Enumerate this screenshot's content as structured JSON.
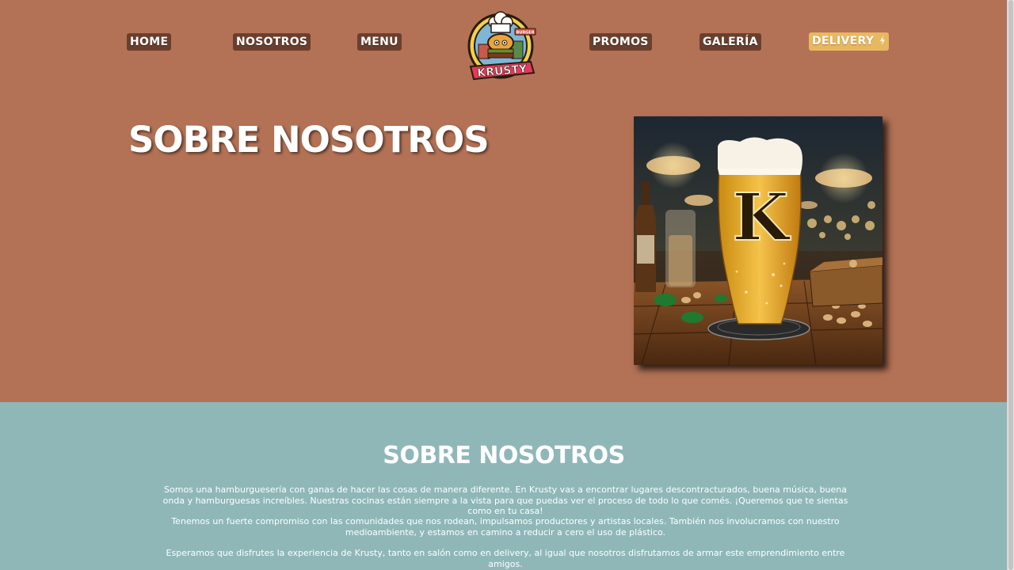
{
  "nav": {
    "items": [
      {
        "label": "HOME"
      },
      {
        "label": "NOSOTROS"
      },
      {
        "label": "MENU"
      },
      {
        "label": "PROMOS"
      },
      {
        "label": "GALERÍA"
      }
    ],
    "delivery_label": "DELIVERY"
  },
  "logo": {
    "text": "KRUSTY",
    "sign_text": "BURGER"
  },
  "hero": {
    "title": "SOBRE NOSOTROS",
    "image_letter": "K"
  },
  "about": {
    "title": "SOBRE NOSOTROS",
    "paragraphs": [
      "Somos una hamburguesería con ganas de hacer las cosas de manera diferente. En Krusty vas a encontrar lugares descontracturados, buena música, buena onda y hamburguesas increíbles. Nuestras cocinas están siempre a la vista para que puedas ver el proceso de todo lo que comés. ¡Queremos que te sientas como en tu casa!",
      "Tenemos un fuerte compromiso con las comunidades que nos rodean, impulsamos productores y artistas locales. También nos involucramos con nuestro medioambiente, y estamos en camino a reducir a cero el uso de plástico.",
      "Esperamos que disfrutes la experiencia de Krusty, tanto en salón como en delivery, al igual que nosotros disfrutamos de armar este emprendimiento entre amigos."
    ]
  },
  "colors": {
    "top_bg": "#b37255",
    "about_bg": "#8fb7b8",
    "nav_btn": "#6b3f2e",
    "delivery_btn": "#e8b860"
  }
}
